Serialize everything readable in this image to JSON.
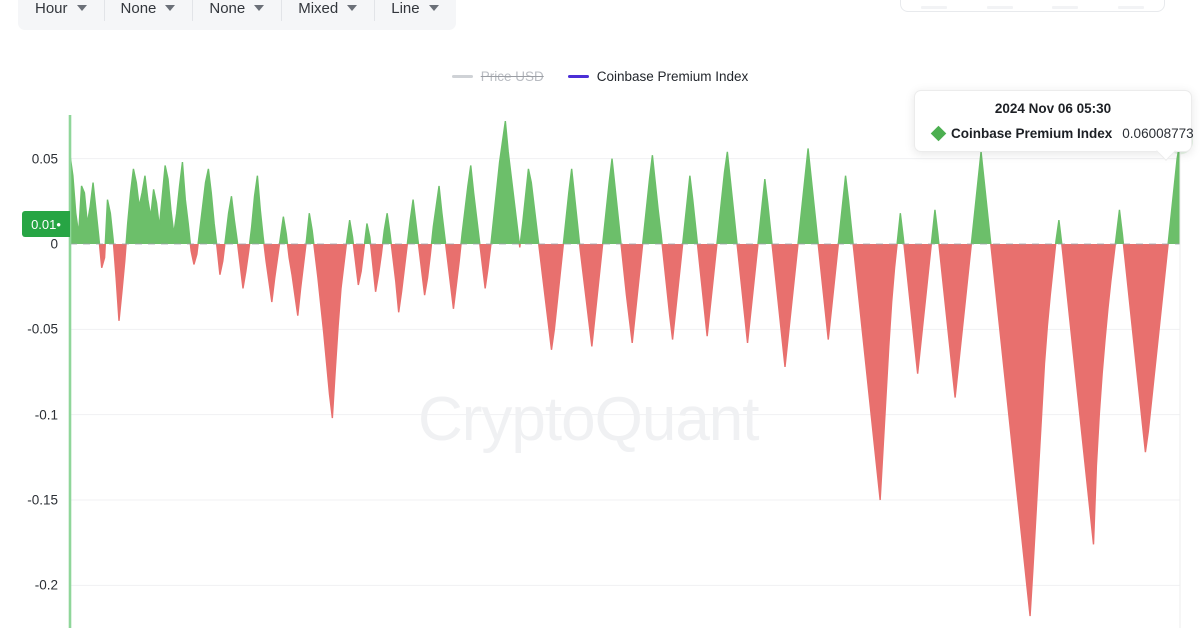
{
  "toolbar": {
    "items": [
      {
        "label": "Hour",
        "icon": "chevron-down-icon"
      },
      {
        "label": "None",
        "icon": "chevron-down-icon"
      },
      {
        "label": "None",
        "icon": "chevron-down-icon"
      },
      {
        "label": "Mixed",
        "icon": "chevron-down-icon"
      },
      {
        "label": "Line",
        "icon": "chevron-down-icon"
      }
    ]
  },
  "legend": [
    {
      "label": "Price USD",
      "color": "#cfd2d6",
      "active": false
    },
    {
      "label": "Coinbase Premium Index",
      "color": "#4b2fd6",
      "active": true
    }
  ],
  "tooltip": {
    "date": "2024 Nov 06 05:30",
    "series_name": "Coinbase Premium Index",
    "value": "0.06008773",
    "marker_color": "#4caf50"
  },
  "watermark": "CryptoQuant",
  "axis": {
    "current_value_badge": "0.01•",
    "badge_color": "#27a544"
  },
  "colors": {
    "positive": "#6cbf6a",
    "negative": "#e8706e",
    "zero_line": "#9aa0a6",
    "grid": "#f0f1f3",
    "cursor_line": "#8fd69a"
  },
  "chart_data": {
    "type": "area",
    "title": "",
    "xlabel": "",
    "ylabel": "",
    "ylim": [
      -0.225,
      0.0785
    ],
    "yticks": [
      0.05,
      0,
      -0.05,
      -0.1,
      -0.15,
      -0.2
    ],
    "ytick_labels": [
      "0.05",
      "0",
      "-0.05",
      "-0.1",
      "-0.15",
      "-0.2"
    ],
    "grid": true,
    "legend_position": "top-center",
    "zero_baseline": 0,
    "series": [
      {
        "name": "Coinbase Premium Index",
        "positive_color": "#6cbf6a",
        "negative_color": "#e8706e",
        "values": [
          0.052,
          0.04,
          0.018,
          0.006,
          0.034,
          0.03,
          0.012,
          0.022,
          0.036,
          0.02,
          0.004,
          -0.014,
          -0.008,
          0.026,
          0.018,
          0.002,
          -0.02,
          -0.045,
          -0.028,
          -0.01,
          0.012,
          0.03,
          0.044,
          0.036,
          0.022,
          0.03,
          0.04,
          0.026,
          0.016,
          0.032,
          0.024,
          0.01,
          0.028,
          0.046,
          0.038,
          0.02,
          0.006,
          0.018,
          0.034,
          0.048,
          0.026,
          0.012,
          -0.004,
          -0.012,
          -0.006,
          0.008,
          0.022,
          0.036,
          0.044,
          0.03,
          0.012,
          -0.002,
          -0.018,
          -0.01,
          0.004,
          0.018,
          0.028,
          0.014,
          0.002,
          -0.012,
          -0.026,
          -0.016,
          -0.004,
          0.01,
          0.028,
          0.04,
          0.02,
          0.004,
          -0.01,
          -0.022,
          -0.034,
          -0.02,
          -0.008,
          0.004,
          0.016,
          0.006,
          -0.008,
          -0.018,
          -0.03,
          -0.042,
          -0.026,
          -0.012,
          0.002,
          0.018,
          0.008,
          -0.006,
          -0.02,
          -0.036,
          -0.052,
          -0.07,
          -0.088,
          -0.102,
          -0.074,
          -0.048,
          -0.026,
          -0.012,
          0.002,
          0.014,
          0.004,
          -0.01,
          -0.024,
          -0.016,
          -0.002,
          0.012,
          0.004,
          -0.012,
          -0.028,
          -0.018,
          -0.006,
          0.008,
          0.018,
          0.006,
          -0.008,
          -0.022,
          -0.04,
          -0.028,
          -0.014,
          0.0,
          0.014,
          0.026,
          0.012,
          -0.002,
          -0.016,
          -0.03,
          -0.02,
          -0.006,
          0.01,
          0.022,
          0.034,
          0.018,
          0.004,
          -0.01,
          -0.024,
          -0.038,
          -0.024,
          -0.01,
          0.006,
          0.02,
          0.034,
          0.046,
          0.03,
          0.016,
          0.002,
          -0.012,
          -0.026,
          -0.014,
          0.0,
          0.016,
          0.032,
          0.048,
          0.06,
          0.072,
          0.054,
          0.04,
          0.026,
          0.012,
          -0.002,
          0.012,
          0.028,
          0.044,
          0.036,
          0.022,
          0.008,
          -0.006,
          -0.02,
          -0.034,
          -0.048,
          -0.062,
          -0.05,
          -0.034,
          -0.018,
          -0.002,
          0.014,
          0.03,
          0.044,
          0.028,
          0.012,
          -0.004,
          -0.018,
          -0.032,
          -0.046,
          -0.06,
          -0.044,
          -0.028,
          -0.012,
          0.004,
          0.02,
          0.036,
          0.05,
          0.034,
          0.018,
          0.002,
          -0.014,
          -0.03,
          -0.044,
          -0.058,
          -0.042,
          -0.026,
          -0.01,
          0.006,
          0.022,
          0.038,
          0.052,
          0.036,
          0.02,
          0.006,
          -0.01,
          -0.026,
          -0.042,
          -0.056,
          -0.04,
          -0.024,
          -0.008,
          0.008,
          0.024,
          0.04,
          0.026,
          0.01,
          -0.006,
          -0.022,
          -0.038,
          -0.054,
          -0.038,
          -0.022,
          -0.006,
          0.01,
          0.026,
          0.042,
          0.054,
          0.038,
          0.022,
          0.006,
          -0.01,
          -0.026,
          -0.042,
          -0.058,
          -0.042,
          -0.026,
          -0.01,
          0.006,
          0.022,
          0.038,
          0.024,
          0.008,
          -0.008,
          -0.024,
          -0.04,
          -0.056,
          -0.072,
          -0.056,
          -0.04,
          -0.024,
          -0.008,
          0.008,
          0.024,
          0.04,
          0.056,
          0.04,
          0.024,
          0.008,
          -0.008,
          -0.024,
          -0.04,
          -0.056,
          -0.04,
          -0.024,
          -0.008,
          0.008,
          0.024,
          0.04,
          0.026,
          0.01,
          -0.006,
          -0.022,
          -0.038,
          -0.054,
          -0.07,
          -0.086,
          -0.102,
          -0.118,
          -0.134,
          -0.15,
          -0.12,
          -0.09,
          -0.06,
          -0.034,
          -0.014,
          0.002,
          0.018,
          0.004,
          -0.012,
          -0.028,
          -0.044,
          -0.06,
          -0.076,
          -0.06,
          -0.044,
          -0.028,
          -0.012,
          0.004,
          0.02,
          0.006,
          -0.01,
          -0.026,
          -0.042,
          -0.058,
          -0.074,
          -0.09,
          -0.074,
          -0.058,
          -0.042,
          -0.026,
          -0.01,
          0.006,
          0.022,
          0.038,
          0.054,
          0.038,
          0.022,
          0.006,
          -0.01,
          -0.026,
          -0.042,
          -0.058,
          -0.074,
          -0.09,
          -0.106,
          -0.122,
          -0.138,
          -0.154,
          -0.17,
          -0.186,
          -0.202,
          -0.218,
          -0.19,
          -0.16,
          -0.13,
          -0.1,
          -0.07,
          -0.048,
          -0.03,
          -0.014,
          0.002,
          0.014,
          0.0,
          -0.016,
          -0.032,
          -0.048,
          -0.064,
          -0.08,
          -0.096,
          -0.112,
          -0.128,
          -0.144,
          -0.16,
          -0.176,
          -0.13,
          -0.1,
          -0.076,
          -0.056,
          -0.038,
          -0.022,
          -0.008,
          0.006,
          0.02,
          0.006,
          -0.01,
          -0.026,
          -0.042,
          -0.058,
          -0.074,
          -0.09,
          -0.106,
          -0.122,
          -0.11,
          -0.094,
          -0.078,
          -0.062,
          -0.046,
          -0.03,
          -0.014,
          0.002,
          0.018,
          0.034,
          0.05,
          0.06
        ],
        "last_point": {
          "label": "2024 Nov 06 05:30",
          "value": 0.06008773
        }
      }
    ]
  }
}
